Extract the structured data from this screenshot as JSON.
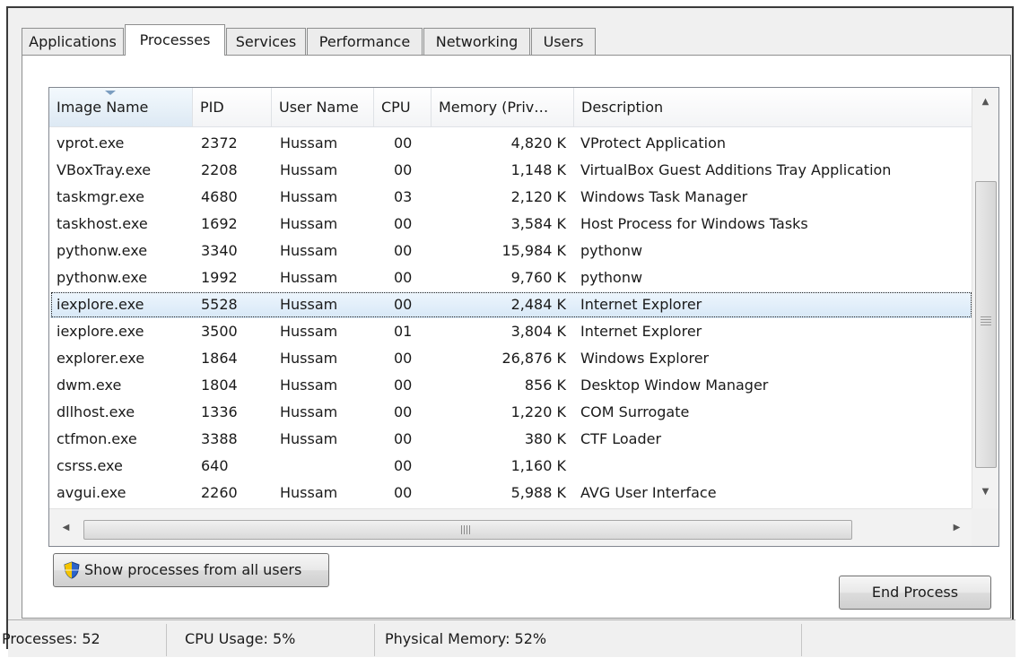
{
  "tabs": [
    {
      "label": "Applications"
    },
    {
      "label": "Processes"
    },
    {
      "label": "Services"
    },
    {
      "label": "Performance"
    },
    {
      "label": "Networking"
    },
    {
      "label": "Users"
    }
  ],
  "active_tab": "Processes",
  "columns": {
    "image_name": "Image Name",
    "pid": "PID",
    "user_name": "User Name",
    "cpu": "CPU",
    "memory": "Memory (Priv…",
    "description": "Description"
  },
  "processes": [
    {
      "image": "vprot.exe",
      "pid": "2372",
      "user": "Hussam",
      "cpu": "00",
      "mem": "4,820 K",
      "desc": "VProtect Application"
    },
    {
      "image": "VBoxTray.exe",
      "pid": "2208",
      "user": "Hussam",
      "cpu": "00",
      "mem": "1,148 K",
      "desc": "VirtualBox Guest Additions Tray Application"
    },
    {
      "image": "taskmgr.exe",
      "pid": "4680",
      "user": "Hussam",
      "cpu": "03",
      "mem": "2,120 K",
      "desc": "Windows Task Manager"
    },
    {
      "image": "taskhost.exe",
      "pid": "1692",
      "user": "Hussam",
      "cpu": "00",
      "mem": "3,584 K",
      "desc": "Host Process for Windows Tasks"
    },
    {
      "image": "pythonw.exe",
      "pid": "3340",
      "user": "Hussam",
      "cpu": "00",
      "mem": "15,984 K",
      "desc": "pythonw"
    },
    {
      "image": "pythonw.exe",
      "pid": "1992",
      "user": "Hussam",
      "cpu": "00",
      "mem": "9,760 K",
      "desc": "pythonw"
    },
    {
      "image": "iexplore.exe",
      "pid": "5528",
      "user": "Hussam",
      "cpu": "00",
      "mem": "2,484 K",
      "desc": "Internet Explorer",
      "selected": true
    },
    {
      "image": "iexplore.exe",
      "pid": "3500",
      "user": "Hussam",
      "cpu": "01",
      "mem": "3,804 K",
      "desc": "Internet Explorer"
    },
    {
      "image": "explorer.exe",
      "pid": "1864",
      "user": "Hussam",
      "cpu": "00",
      "mem": "26,876 K",
      "desc": "Windows Explorer"
    },
    {
      "image": "dwm.exe",
      "pid": "1804",
      "user": "Hussam",
      "cpu": "00",
      "mem": "856 K",
      "desc": "Desktop Window Manager"
    },
    {
      "image": "dllhost.exe",
      "pid": "1336",
      "user": "Hussam",
      "cpu": "00",
      "mem": "1,220 K",
      "desc": "COM Surrogate"
    },
    {
      "image": "ctfmon.exe",
      "pid": "3388",
      "user": "Hussam",
      "cpu": "00",
      "mem": "380 K",
      "desc": "CTF Loader"
    },
    {
      "image": "csrss.exe",
      "pid": "640",
      "user": "",
      "cpu": "00",
      "mem": "1,160 K",
      "desc": ""
    },
    {
      "image": "avgui.exe",
      "pid": "2260",
      "user": "Hussam",
      "cpu": "00",
      "mem": "5,988 K",
      "desc": "AVG User Interface"
    }
  ],
  "buttons": {
    "show_all": "Show processes from all users",
    "end_process": "End Process"
  },
  "status": {
    "processes": "Processes: 52",
    "cpu": "CPU Usage: 5%",
    "memory": "Physical Memory: 52%"
  },
  "icons": {
    "shield": "uac-shield-icon",
    "scroll_up": "▲",
    "scroll_down": "▼",
    "scroll_left": "◀",
    "scroll_right": "▶",
    "grip": "Ⅲ"
  },
  "colors": {
    "selection": "#d7e8f7",
    "panel": "#ffffff",
    "window": "#f0f0f0"
  }
}
